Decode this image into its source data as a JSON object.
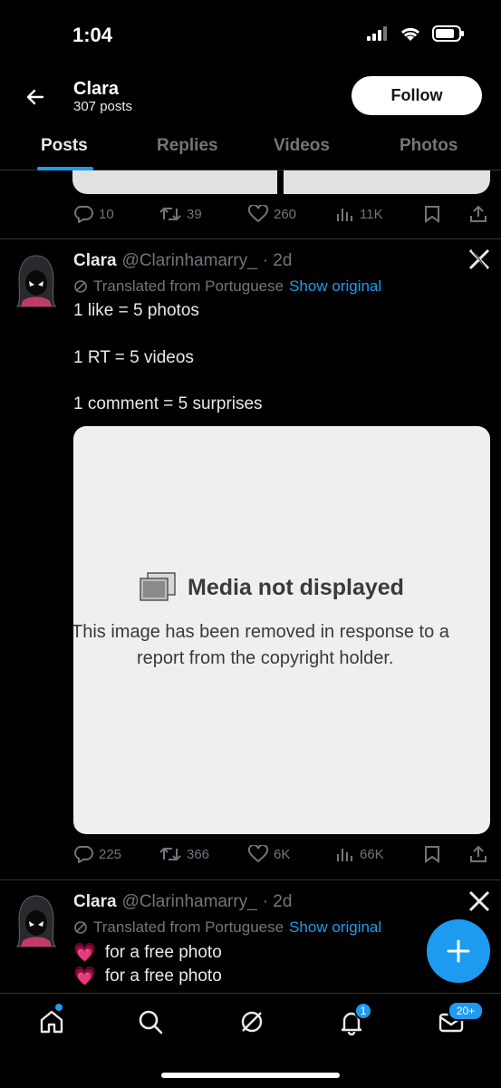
{
  "status_bar": {
    "time": "1:04"
  },
  "header": {
    "name": "Clara",
    "post_count": "307 posts",
    "follow_label": "Follow"
  },
  "tabs": [
    {
      "label": "Posts",
      "active": true
    },
    {
      "label": "Replies",
      "active": false
    },
    {
      "label": "Videos",
      "active": false
    },
    {
      "label": "Photos",
      "active": false
    }
  ],
  "prev_tweet": {
    "replies": "10",
    "retweets": "39",
    "likes": "260",
    "views": "11K"
  },
  "tweet1": {
    "name": "Clara",
    "handle": "@Clarinhamarry_",
    "age": "· 2d",
    "translated": "Translated from Portuguese",
    "show_original": "Show original",
    "lines": [
      "1 like = 5 photos",
      "1 RT = 5 videos",
      "1 comment = 5 surprises"
    ],
    "media": {
      "title": "Media not displayed",
      "desc_line1": "This image has been removed in response to a",
      "desc_line2": "report from the copyright holder."
    },
    "replies": "225",
    "retweets": "366",
    "likes": "6K",
    "views": "66K"
  },
  "tweet2": {
    "name": "Clara",
    "handle": "@Clarinhamarry_",
    "age": "· 2d",
    "translated": "Translated from Portuguese",
    "show_original": "Show original",
    "lines": [
      "for a free photo",
      "for a free photo"
    ]
  },
  "bottom_nav": {
    "notifications_badge": "1",
    "messages_badge": "20+"
  },
  "colors": {
    "accent": "#1d9bf0",
    "background": "#000000",
    "muted": "#71767b"
  }
}
